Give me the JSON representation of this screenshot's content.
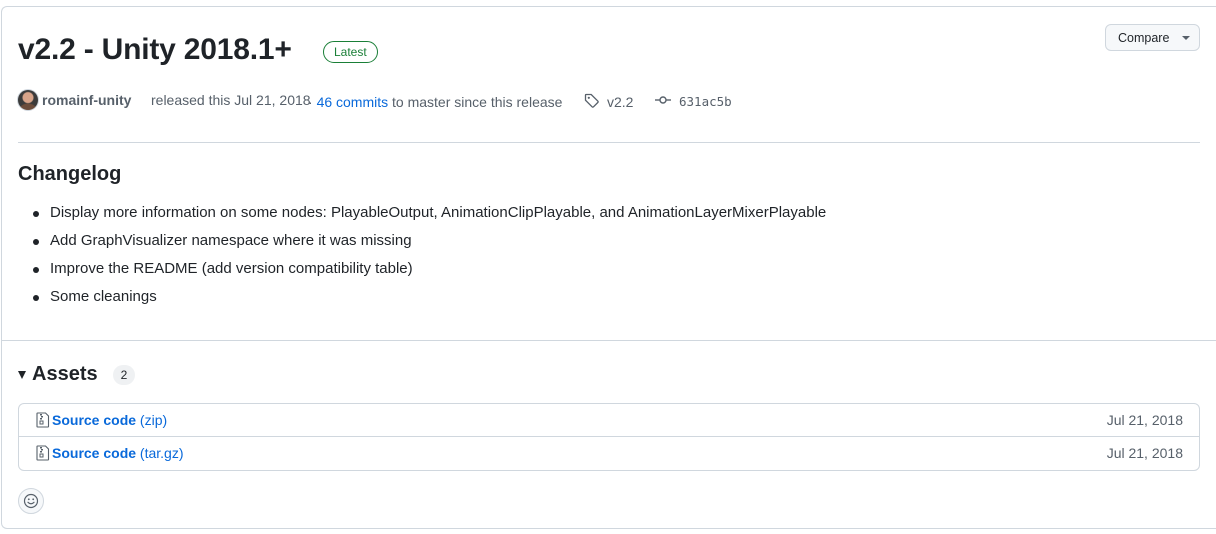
{
  "release": {
    "title": "v2.2 - Unity 2018.1+",
    "badge": "Latest",
    "compare_label": "Compare",
    "author": "romainf-unity",
    "released_text": "released this Jul 21, 2018",
    "commits_prefix": "·",
    "commits_link": "46 commits",
    "commits_suffix": "to master since this release",
    "tag": "v2.2",
    "commit_hash": "631ac5b"
  },
  "changelog": {
    "heading": "Changelog",
    "items": [
      "Display more information on some nodes: PlayableOutput, AnimationClipPlayable, and AnimationLayerMixerPlayable",
      "Add GraphVisualizer namespace where it was missing",
      "Improve the README (add version compatibility table)",
      "Some cleanings"
    ]
  },
  "assets": {
    "title": "Assets",
    "count": "2",
    "rows": [
      {
        "name": "Source code",
        "ext": "(zip)",
        "date": "Jul 21, 2018"
      },
      {
        "name": "Source code",
        "ext": "(tar.gz)",
        "date": "Jul 21, 2018"
      }
    ]
  },
  "icons": {
    "tag": "tag-icon",
    "commit": "git-commit-icon",
    "zip": "file-zip-icon",
    "reaction": "smiley-icon"
  },
  "colors": {
    "link": "#0969da",
    "latest": "#1a7f37",
    "border": "#d0d7de",
    "muted": "#57606a"
  }
}
